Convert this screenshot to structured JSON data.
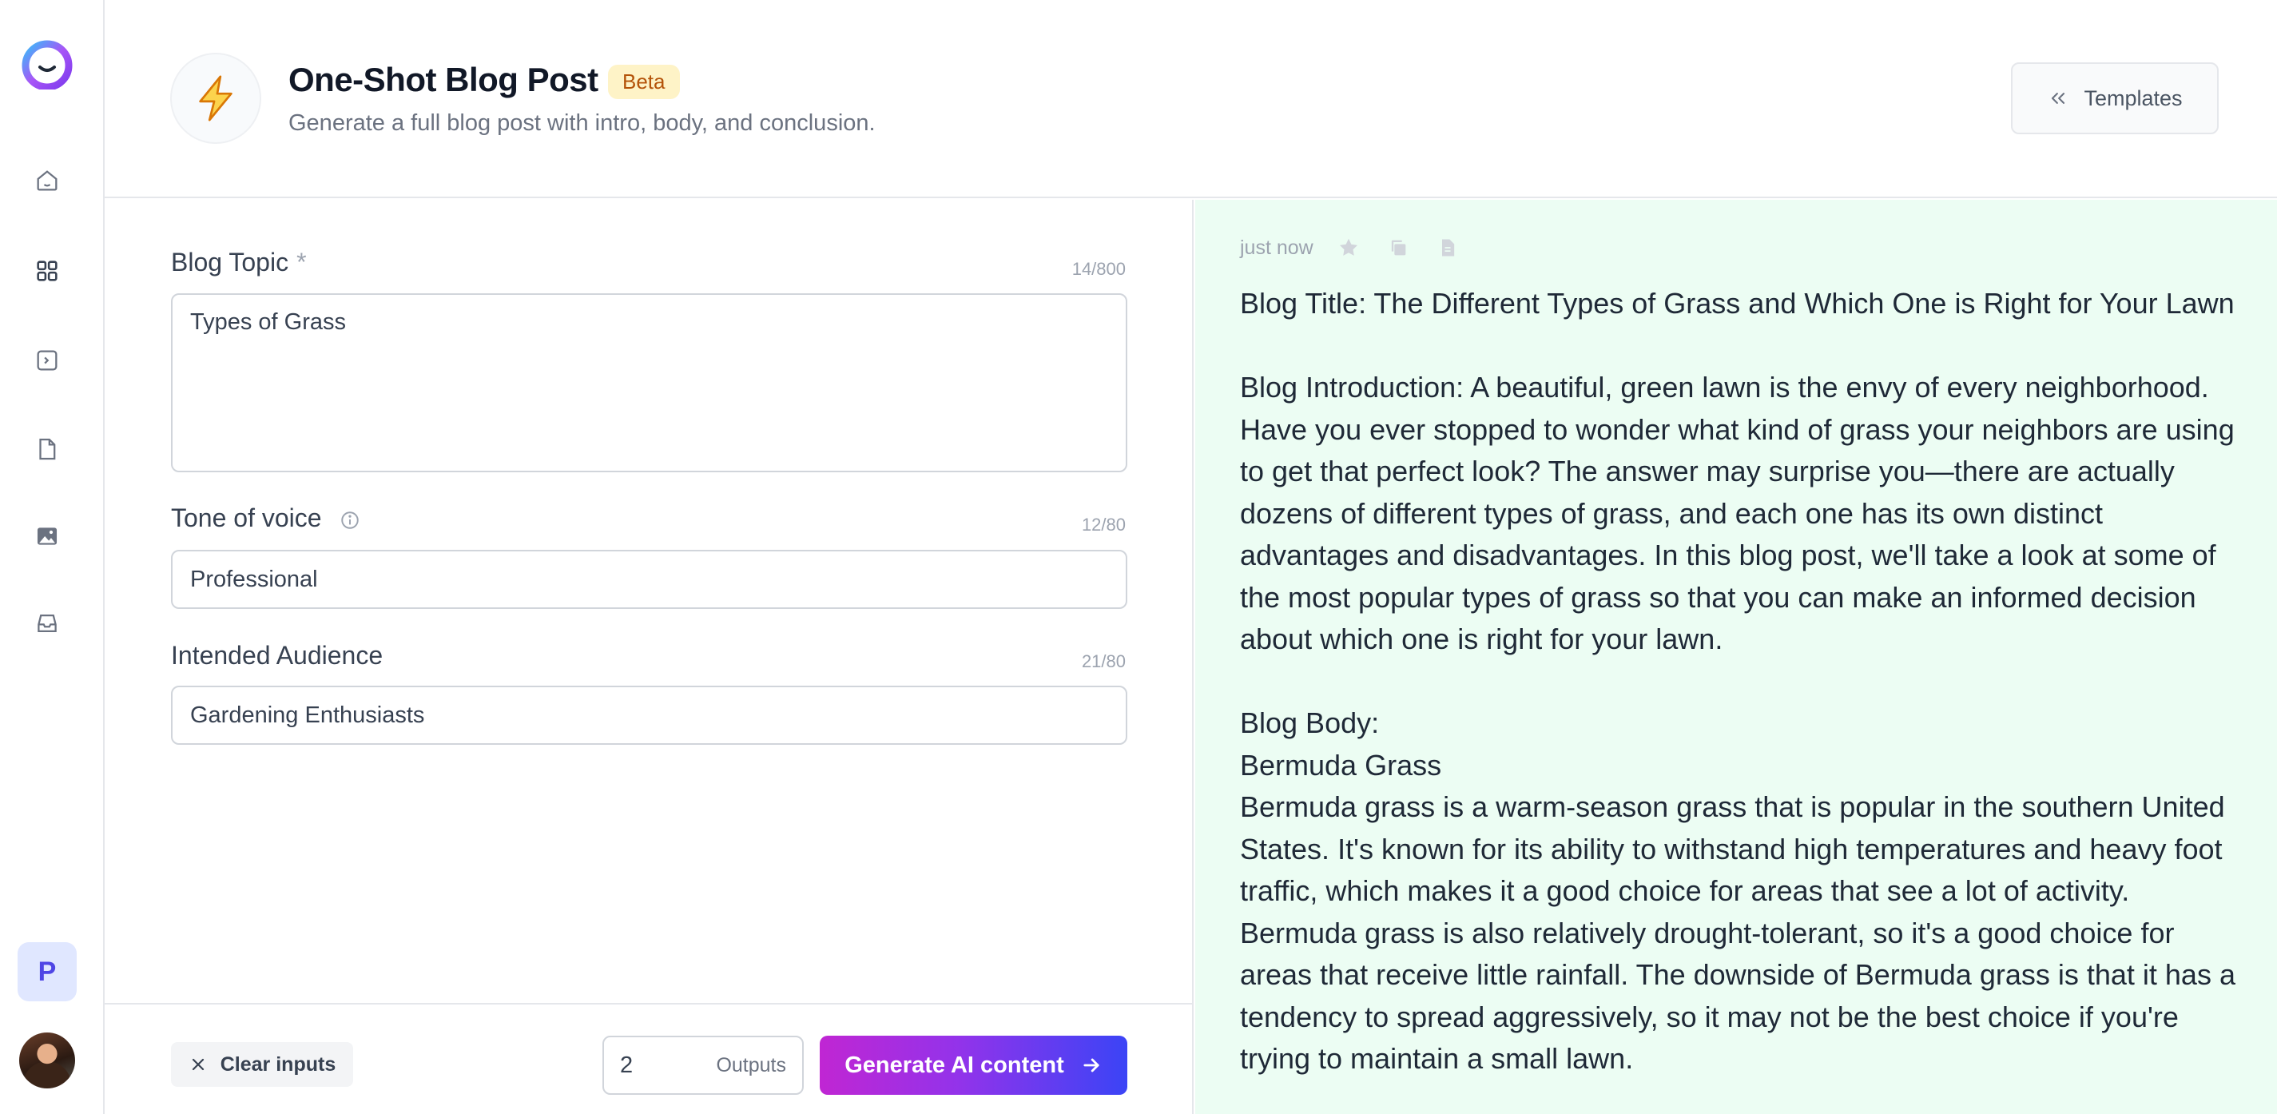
{
  "app": {
    "logo_icon": "jasper-face-logo",
    "nav_icons": [
      "home-icon",
      "grid-icon",
      "terminal-icon",
      "document-icon",
      "image-icon",
      "inbox-icon"
    ],
    "workspace_initial": "P"
  },
  "header": {
    "title": "One-Shot Blog Post",
    "badge": "Beta",
    "subtitle": "Generate a full blog post with intro, body, and conclusion.",
    "templates_label": "Templates"
  },
  "form": {
    "blog_topic": {
      "label": "Blog Topic",
      "required_mark": "*",
      "value": "Types of Grass",
      "counter": "14/800"
    },
    "tone": {
      "label": "Tone of voice",
      "value": "Professional",
      "counter": "12/80"
    },
    "audience": {
      "label": "Intended Audience",
      "value": "Gardening Enthusiasts",
      "counter": "21/80"
    },
    "clear_label": "Clear inputs",
    "outputs_value": "2",
    "outputs_label": "Outputs",
    "generate_label": "Generate AI content"
  },
  "output": {
    "timestamp": "just now",
    "blog_title": "Blog Title: The Different Types of Grass and Which One is Right for Your Lawn",
    "introduction": "Blog Introduction: A beautiful, green lawn is the envy of every neighborhood. Have you ever stopped to wonder what kind of grass your neighbors are using to get that perfect look? The answer may surprise you—there are actually dozens of different types of grass, and each one has its own distinct advantages and disadvantages. In this blog post, we'll take a look at some of the most popular types of grass so that you can make an informed decision about which one is right for your lawn.",
    "body_heading": "Blog Body:",
    "section_heading": "Bermuda Grass",
    "section_text": "Bermuda grass is a warm-season grass that is popular in the southern United States. It's known for its ability to withstand high temperatures and heavy foot traffic, which makes it a good choice for areas that see a lot of activity. Bermuda grass is also relatively drought-tolerant, so it's a good choice for areas that receive little rainfall. The downside of Bermuda grass is that it has a tendency to spread aggressively, so it may not be the best choice if you're trying to maintain a small lawn."
  },
  "colors": {
    "accent_gradient_start": "#c026d3",
    "accent_gradient_end": "#3b44f6",
    "output_bg": "#ecfdf3",
    "beta_bg": "#fef3c7",
    "beta_text": "#b45309"
  }
}
